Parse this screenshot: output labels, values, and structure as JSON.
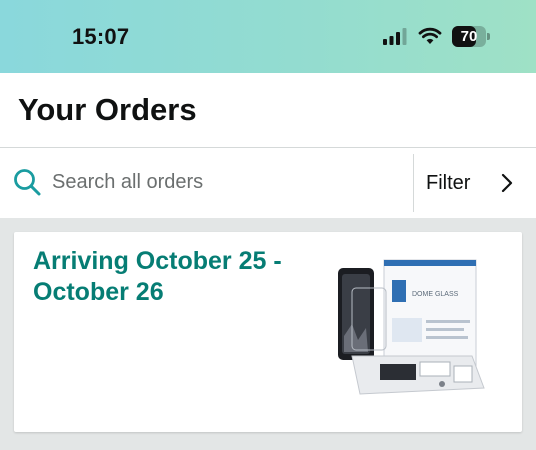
{
  "status_bar": {
    "time": "15:07",
    "battery_level": "70",
    "battery_fraction": 0.7
  },
  "page": {
    "title": "Your Orders"
  },
  "search": {
    "placeholder": "Search all orders",
    "value": ""
  },
  "filter": {
    "label": "Filter"
  },
  "orders": [
    {
      "delivery_status": "Arriving October 25 - October 26",
      "product_image_alt": "Dome Glass screen protector kit",
      "product_box_text": "DOME GLASS"
    }
  ],
  "colors": {
    "status_bar_gradient_start": "#8ad8dc",
    "status_bar_gradient_end": "#9fe1c6",
    "delivery_status": "#067d74",
    "search_icon": "#1a9ca0",
    "background_gray": "#e3e6e6"
  },
  "icons": {
    "signal": "cellular-signal-icon",
    "wifi": "wifi-icon",
    "battery": "battery-icon",
    "search": "search-icon",
    "chevron": "chevron-right-icon"
  }
}
